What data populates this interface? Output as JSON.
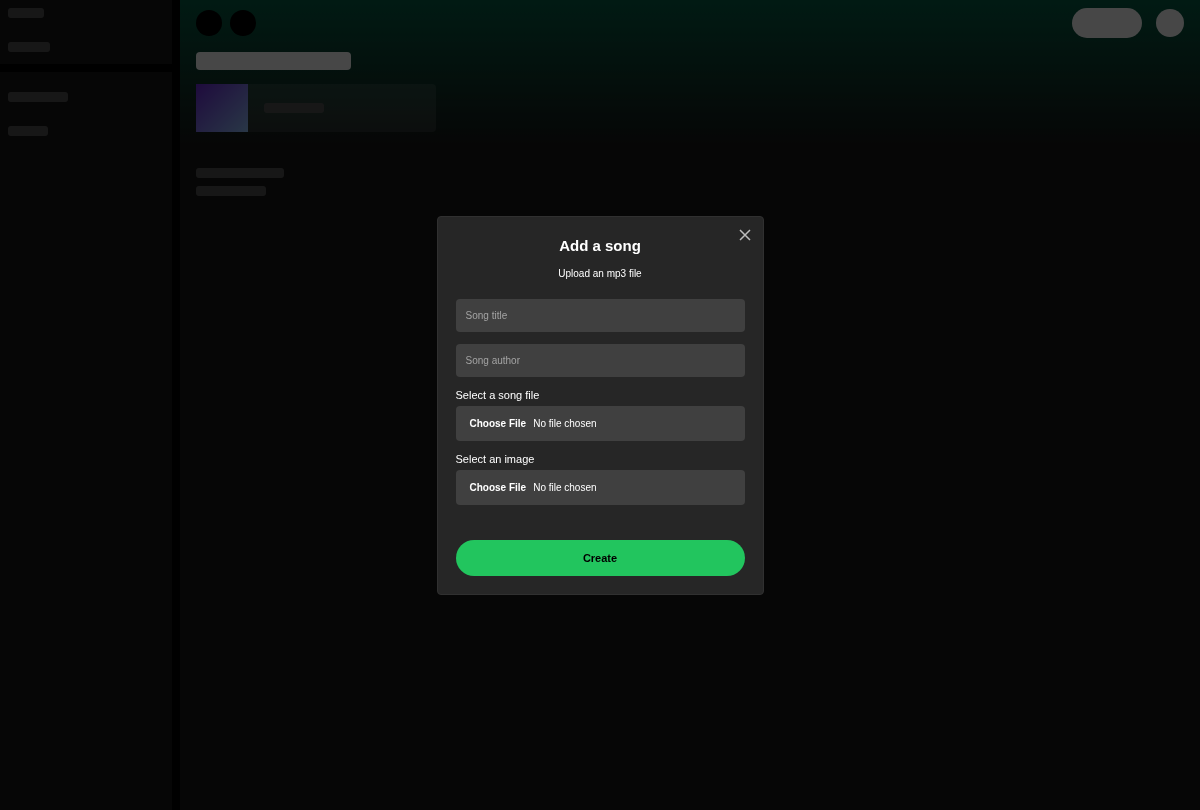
{
  "modal": {
    "title": "Add a song",
    "description": "Upload an mp3 file",
    "fields": [
      {
        "kind": "text",
        "placeholder": "Song title"
      },
      {
        "kind": "text",
        "placeholder": "Song author"
      },
      {
        "kind": "file",
        "label": "Select a song file",
        "button": "Choose File",
        "status": "No file chosen"
      },
      {
        "kind": "file",
        "label": "Select an image",
        "button": "Choose File",
        "status": "No file chosen"
      }
    ],
    "submit": "Create"
  }
}
